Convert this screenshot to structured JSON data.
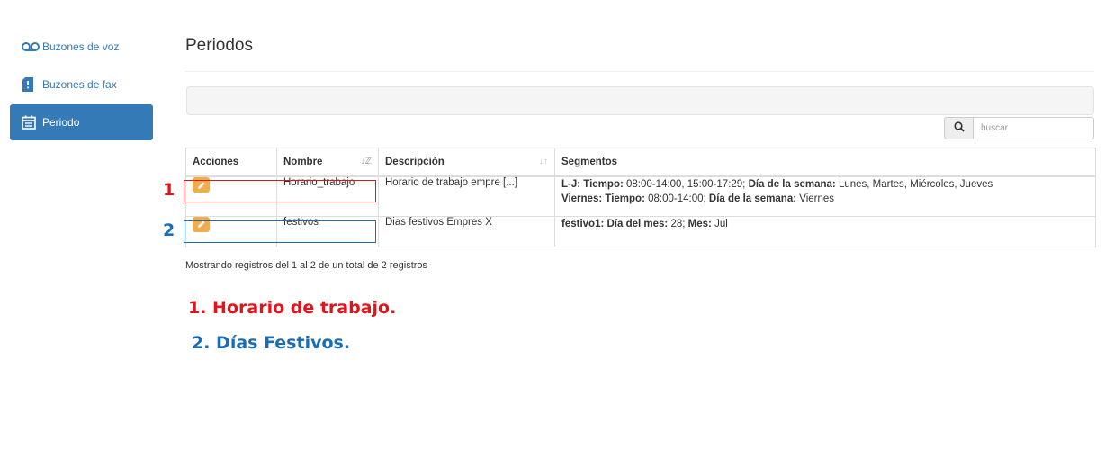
{
  "sidebar": {
    "items": [
      {
        "label": "Buzones de voz",
        "icon": "voicemail-icon",
        "active": false
      },
      {
        "label": "Buzones de fax",
        "icon": "fax-icon",
        "active": false
      },
      {
        "label": "Periodo",
        "icon": "calendar-icon",
        "active": true
      }
    ]
  },
  "page": {
    "title": "Periodos"
  },
  "search": {
    "placeholder": "buscar",
    "value": ""
  },
  "table": {
    "headers": {
      "acciones": "Acciones",
      "nombre": "Nombre",
      "descripcion": "Descripción",
      "segmentos": "Segmentos"
    },
    "rows": [
      {
        "nombre": "Horario_trabajo",
        "descripcion": "Horario de trabajo empre [...]",
        "seg1": {
          "name": "L-J:",
          "k1": "Tiempo:",
          "v1": "08:00-14:00, 15:00-17:29;",
          "k2": "Día de la semana:",
          "v2": "Lunes, Martes, Miércoles, Jueves"
        },
        "seg2": {
          "name": "Viernes:",
          "k1": "Tiempo:",
          "v1": "08:00-14:00;",
          "k2": "Día de la semana:",
          "v2": "Viernes"
        }
      },
      {
        "nombre": "festivos",
        "descripcion": "Dias festivos Empres X",
        "seg1": {
          "name": "festivo1:",
          "k1": "Día del mes:",
          "v1": "28;",
          "k2": "Mes:",
          "v2": "Jul"
        }
      }
    ]
  },
  "footer": {
    "info": "Mostrando registros del 1 al 2 de un total de 2 registros"
  },
  "annotations": {
    "num1": "1",
    "num2": "2",
    "legend1": "1. Horario de trabajo.",
    "legend2": "2. Días Festivos.",
    "color_red": "#e0141b",
    "color_blue": "#1a6db4"
  },
  "colors": {
    "primary": "#337ab7",
    "warning": "#f0ad4e"
  }
}
